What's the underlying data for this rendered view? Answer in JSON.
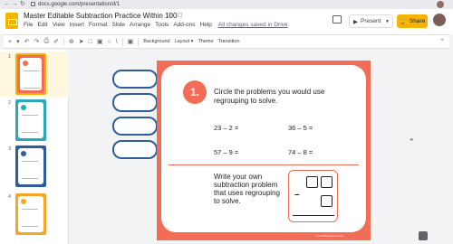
{
  "browser": {
    "url": "docs.google.com/presentation/d/1"
  },
  "header": {
    "doc_title": "Master Editable Subtraction Practice Within 100",
    "menu": [
      "File",
      "Edit",
      "View",
      "Insert",
      "Format",
      "Slide",
      "Arrange",
      "Tools",
      "Add-ons",
      "Help"
    ],
    "saved_note": "All changes saved in Drive",
    "present_label": "Present",
    "share_label": "Share"
  },
  "toolbar": {
    "background_label": "Background",
    "layout_label": "Layout ▾",
    "theme_label": "Theme",
    "transition_label": "Transition"
  },
  "filmstrip": {
    "slide_numbers": [
      "1",
      "2",
      "3",
      "4"
    ]
  },
  "slide": {
    "badge": "1.",
    "prompt": "Circle the problems you would use regrouping to solve.",
    "problems": [
      "23 – 2 =",
      "36 – 5 =",
      "57 – 9 =",
      "74 – 8 ="
    ],
    "write_prompt": "Write your own subtraction problem that uses regrouping to solve.",
    "minus": "–",
    "credit": "© Lil Philosophers Plus"
  },
  "colors": {
    "accent": "#f36c56",
    "share": "#f6b400",
    "outline": "#2f5c9e"
  }
}
